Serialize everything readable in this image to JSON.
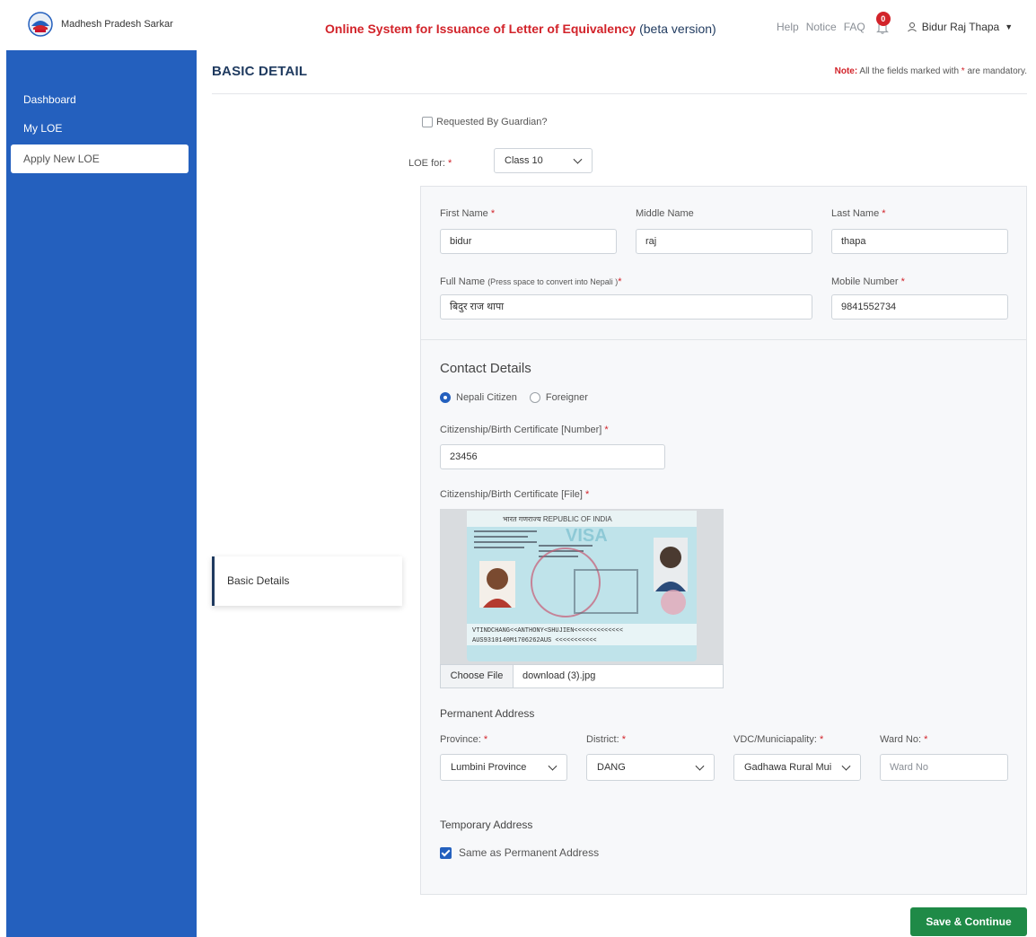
{
  "header": {
    "brand_name": "Madhesh Pradesh Sarkar",
    "title": "Online System for Issuance of Letter of Equivalency",
    "title_suffix": "(beta version)",
    "nav": [
      "Help",
      "Notice",
      "FAQ"
    ],
    "notification_count": "0",
    "user_name": "Bidur Raj Thapa"
  },
  "sidebar": {
    "items": [
      {
        "label": "Dashboard"
      },
      {
        "label": "My LOE"
      },
      {
        "label": "Apply New LOE"
      }
    ]
  },
  "page": {
    "section_title": "BASIC DETAIL",
    "note_prefix": "Note:",
    "note_text": "All the fields marked with",
    "note_star": "*",
    "note_suffix": "are mandatory.",
    "step_label": "Basic Details"
  },
  "form": {
    "guardian_label": "Requested By Guardian?",
    "loe_for_label": "LOE for:",
    "loe_for_value": "Class 10",
    "first_name_label": "First Name",
    "first_name_value": "bidur",
    "middle_name_label": "Middle Name",
    "middle_name_value": "raj",
    "last_name_label": "Last Name",
    "last_name_value": "thapa",
    "full_name_label": "Full Name",
    "full_name_hint": "(Press space to convert into Nepali )",
    "full_name_value": "बिदुर राज थापा",
    "mobile_label": "Mobile Number",
    "mobile_value": "9841552734",
    "contact_heading": "Contact Details",
    "radio_nepali": "Nepali Citizen",
    "radio_foreigner": "Foreigner",
    "cert_number_label": "Citizenship/Birth Certificate [Number]",
    "cert_number_value": "23456",
    "cert_file_label": "Citizenship/Birth Certificate [File]",
    "choose_file": "Choose File",
    "file_name": "download (3).jpg",
    "permanent_heading": "Permanent Address",
    "province_label": "Province:",
    "province_value": "Lumbini Province",
    "district_label": "District:",
    "district_value": "DANG",
    "vdc_label": "VDC/Municiapality:",
    "vdc_value": "Gadhawa Rural Mui",
    "ward_label": "Ward No:",
    "ward_placeholder": "Ward No",
    "temporary_heading": "Temporary Address",
    "same_as_label": "Same as Permanent Address",
    "save_button": "Save & Continue"
  },
  "document_preview": {
    "header_text": "भारत गणराज्य REPUBLIC OF INDIA",
    "watermark": "VISA",
    "mrz_line1": "VTINDCHANG<<ANTHONY<SHUJIEN<<<<<<<<<<<<<",
    "mrz_line2": "AUS9310140M1706262AUS <<<<<<<<<<<"
  },
  "colors": {
    "sidebar": "#2460be",
    "accent_red": "#d2232a",
    "save_green": "#1f8a47",
    "title_navy": "#1f3a5f"
  }
}
